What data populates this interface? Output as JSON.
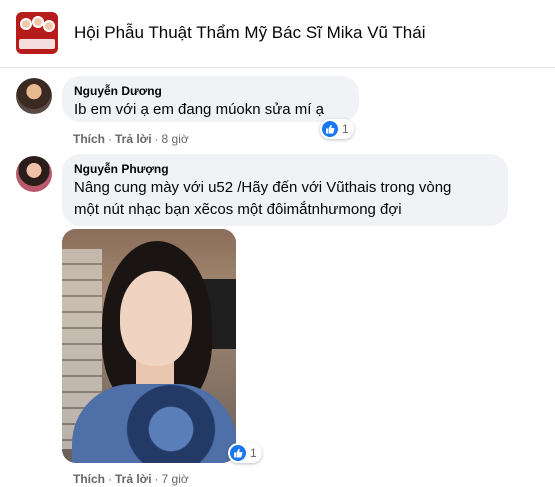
{
  "group": {
    "title": "Hội Phẫu Thuật Thẩm Mỹ Bác Sĩ Mika Vũ Thái"
  },
  "comments": [
    {
      "author": "Nguyễn Dương",
      "text": "Ib em với ạ em đang múokn sửa mí ạ",
      "reaction_count": "1",
      "actions": {
        "like": "Thích",
        "reply": "Trả lời",
        "time": "8 giờ",
        "separator": "·"
      }
    },
    {
      "author": "Nguyễn Phượng",
      "text_lines": [
        "Nâng cung mày với u52 /Hãy đến với Vũthais trong vòng",
        "một nút nhạc bạn xẽcos một đôimắtnhưmong đợi"
      ],
      "reaction_count": "1",
      "actions": {
        "like": "Thích",
        "reply": "Trả lời",
        "time": "7 giờ",
        "separator": "·"
      }
    }
  ],
  "colors": {
    "bubble": "#f0f2f5",
    "like_blue": "#1877f2",
    "meta_gray": "#65676b"
  }
}
